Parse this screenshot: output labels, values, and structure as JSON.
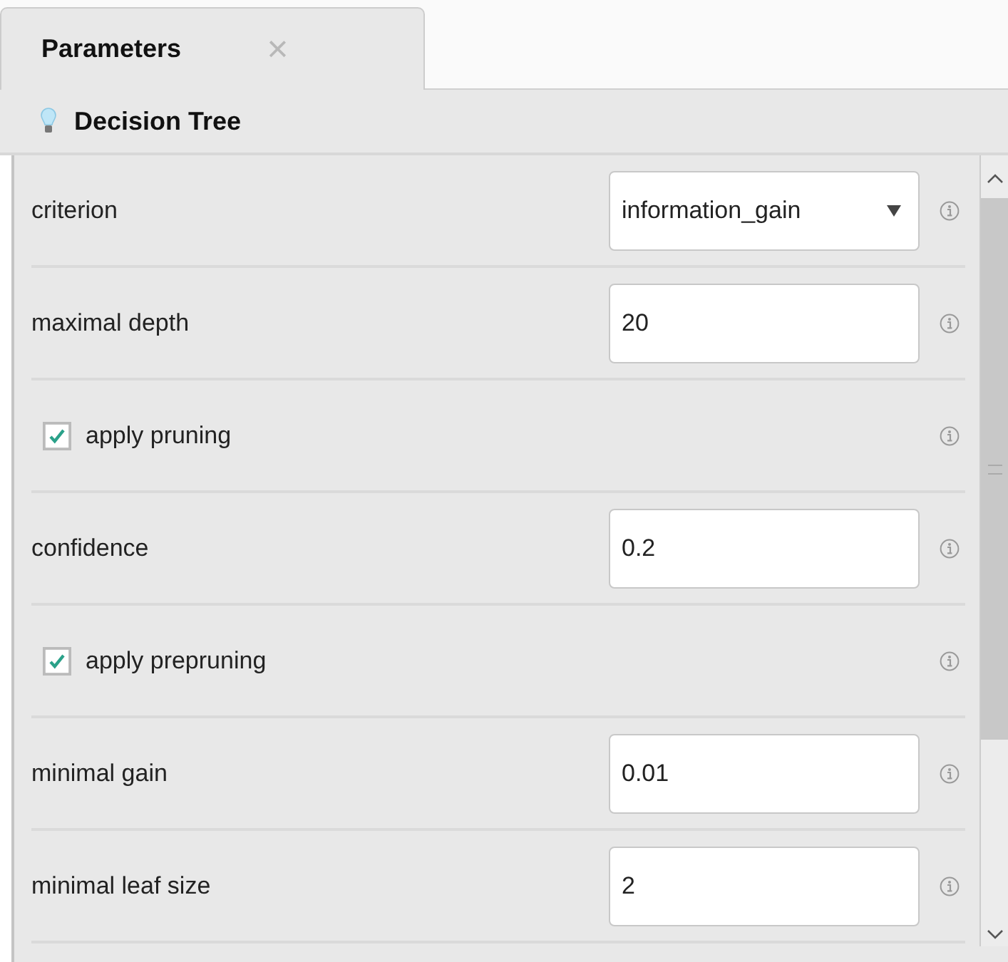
{
  "tabs": [
    {
      "label": "Parameters",
      "selected": true,
      "close": "×"
    }
  ],
  "operator": {
    "title": "Decision Tree"
  },
  "parameters": [
    {
      "kind": "dropdown",
      "label": "criterion",
      "value": "information_gain"
    },
    {
      "kind": "text",
      "label": "maximal depth",
      "value": "20"
    },
    {
      "kind": "checkbox",
      "label": "apply pruning",
      "checked": true
    },
    {
      "kind": "text",
      "label": "confidence",
      "value": "0.2"
    },
    {
      "kind": "checkbox",
      "label": "apply prepruning",
      "checked": true
    },
    {
      "kind": "text",
      "label": "minimal gain",
      "value": "0.01"
    },
    {
      "kind": "text",
      "label": "minimal leaf size",
      "value": "2"
    }
  ]
}
